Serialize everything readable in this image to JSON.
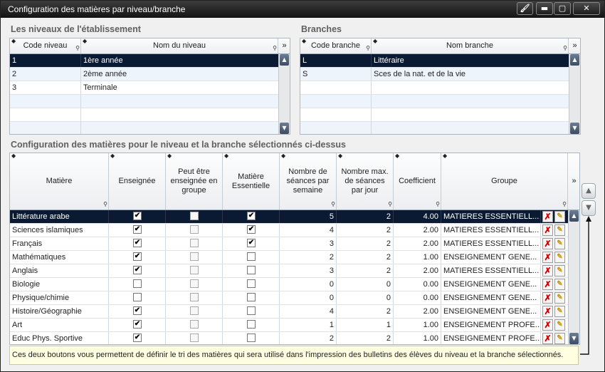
{
  "window": {
    "title": "Configuration des matières par niveau/branche"
  },
  "niveaux": {
    "title": "Les niveaux de l'établissement",
    "headers": {
      "code": "Code niveau",
      "nom": "Nom du niveau"
    },
    "rows": [
      {
        "code": "1",
        "nom": "1ère année"
      },
      {
        "code": "2",
        "nom": "2ème année"
      },
      {
        "code": "3",
        "nom": "Terminale"
      }
    ]
  },
  "branches": {
    "title": "Branches",
    "headers": {
      "code": "Code branche",
      "nom": "Nom branche"
    },
    "rows": [
      {
        "code": "L",
        "nom": "Littéraire"
      },
      {
        "code": "S",
        "nom": "Sces de la nat. et de la vie"
      }
    ]
  },
  "config": {
    "title": "Configuration des matières pour le niveau et la branche sélectionnés ci-dessus",
    "headers": {
      "matiere": "Matière",
      "enseignee": "Enseignée",
      "groupe_ok": "Peut être enseignée en groupe",
      "essentielle": "Matière Essentielle",
      "nb_seances": "Nombre de séances par semaine",
      "nb_max": "Nombre max. de séances par jour",
      "coef": "Coefficient",
      "groupe": "Groupe"
    },
    "rows": [
      {
        "matiere": "Littérature arabe",
        "enseignee": true,
        "groupe_ok": false,
        "essentielle": true,
        "nb_seances": "5",
        "nb_max": "2",
        "coef": "4.00",
        "groupe": "MATIERES ESSENTIELL..."
      },
      {
        "matiere": "Sciences islamiques",
        "enseignee": true,
        "groupe_ok": false,
        "essentielle": true,
        "nb_seances": "4",
        "nb_max": "2",
        "coef": "2.00",
        "groupe": "MATIERES ESSENTIELL..."
      },
      {
        "matiere": "Français",
        "enseignee": true,
        "groupe_ok": false,
        "essentielle": true,
        "nb_seances": "3",
        "nb_max": "2",
        "coef": "2.00",
        "groupe": "MATIERES ESSENTIELL..."
      },
      {
        "matiere": "Mathématiques",
        "enseignee": true,
        "groupe_ok": false,
        "essentielle": false,
        "nb_seances": "2",
        "nb_max": "2",
        "coef": "1.00",
        "groupe": "ENSEIGNEMENT GENE..."
      },
      {
        "matiere": "Anglais",
        "enseignee": true,
        "groupe_ok": false,
        "essentielle": false,
        "nb_seances": "3",
        "nb_max": "2",
        "coef": "2.00",
        "groupe": "MATIERES ESSENTIELL..."
      },
      {
        "matiere": "Biologie",
        "enseignee": false,
        "groupe_ok": false,
        "essentielle": false,
        "nb_seances": "0",
        "nb_max": "0",
        "coef": "0.00",
        "groupe": "ENSEIGNEMENT GENE..."
      },
      {
        "matiere": "Physique/chimie",
        "enseignee": false,
        "groupe_ok": false,
        "essentielle": false,
        "nb_seances": "0",
        "nb_max": "0",
        "coef": "0.00",
        "groupe": "ENSEIGNEMENT GENE..."
      },
      {
        "matiere": "Histoire/Géographie",
        "enseignee": true,
        "groupe_ok": false,
        "essentielle": false,
        "nb_seances": "4",
        "nb_max": "2",
        "coef": "2.00",
        "groupe": "ENSEIGNEMENT GENE..."
      },
      {
        "matiere": "Art",
        "enseignee": true,
        "groupe_ok": false,
        "essentielle": false,
        "nb_seances": "1",
        "nb_max": "1",
        "coef": "1.00",
        "groupe": "ENSEIGNEMENT PROFE..."
      },
      {
        "matiere": "Educ Phys. Sportive",
        "enseignee": true,
        "groupe_ok": false,
        "essentielle": false,
        "nb_seances": "2",
        "nb_max": "2",
        "coef": "1.00",
        "groupe": "ENSEIGNEMENT PROFE..."
      }
    ]
  },
  "hint": "Ces deux boutons vous permettent de définir le tri des matières qui sera utilisé dans l'impression des bulletins des élèves du niveau et la branche sélectionnés.",
  "icons": {
    "brush": "brush-icon",
    "minimize": "minimize-icon",
    "maximize": "maximize-icon",
    "close": "close-icon",
    "delete": "delete-icon",
    "edit": "edit-icon",
    "sort_up": "move-up-icon",
    "sort_down": "move-down-icon"
  },
  "colors": {
    "selected_row": "#0a1a33",
    "title_bar": "#1e1e1e",
    "hint_bg": "#ffffe1",
    "delete_red": "#d00000"
  }
}
